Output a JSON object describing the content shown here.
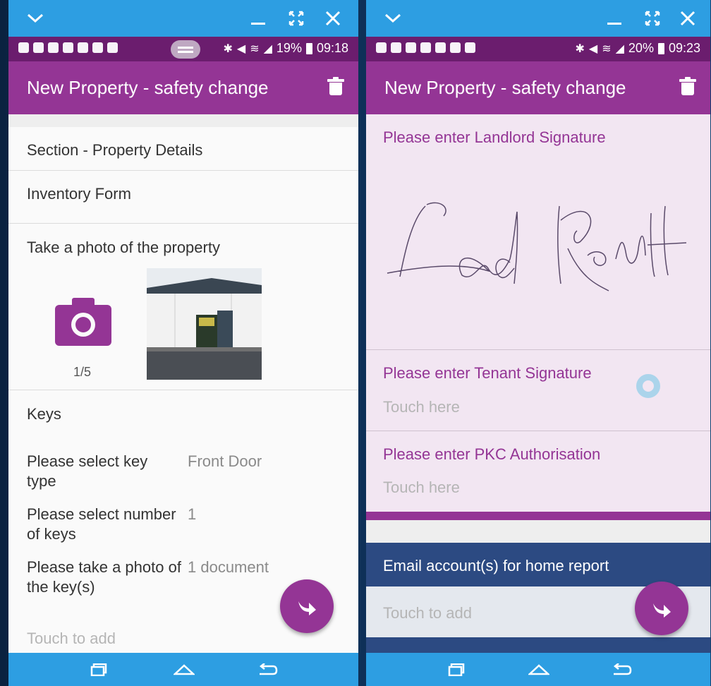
{
  "left_screen": {
    "status": {
      "battery": "19%",
      "time": "09:18"
    },
    "app_title": "New Property - safety change",
    "section_title": "Section - Property Details",
    "form_title": "Inventory Form",
    "photo_prompt": "Take a photo of the property",
    "photo_count": "1/5",
    "keys_heading": "Keys",
    "key_type_label": "Please select key type",
    "key_type_value": "Front Door",
    "num_keys_label": "Please select number of keys",
    "num_keys_value": "1",
    "key_photo_label": "Please take a photo of the key(s)",
    "key_photo_value": "1 document",
    "touch_to_add": "Touch to add"
  },
  "right_screen": {
    "status": {
      "battery": "20%",
      "time": "09:23"
    },
    "app_title": "New Property - safety change",
    "landlord_sig_label": "Please enter Landlord Signature",
    "tenant_sig_label": "Please enter Tenant Signature",
    "tenant_sig_placeholder": "Touch here",
    "pkc_label": "Please enter PKC Authorisation",
    "pkc_placeholder": "Touch here",
    "email_heading": "Email account(s) for home report",
    "email_placeholder": "Touch to add"
  },
  "colors": {
    "brand_purple": "#943595",
    "status_purple": "#6b1d6e",
    "window_blue": "#2d9ee2",
    "signature_bg": "#f2e6f2",
    "email_header": "#2c4a82"
  },
  "icons": [
    "chevron-down-icon",
    "minimize-icon",
    "maximize-icon",
    "close-icon",
    "trash-icon",
    "camera-icon",
    "forward-icon",
    "recents-icon",
    "home-icon",
    "back-icon"
  ]
}
